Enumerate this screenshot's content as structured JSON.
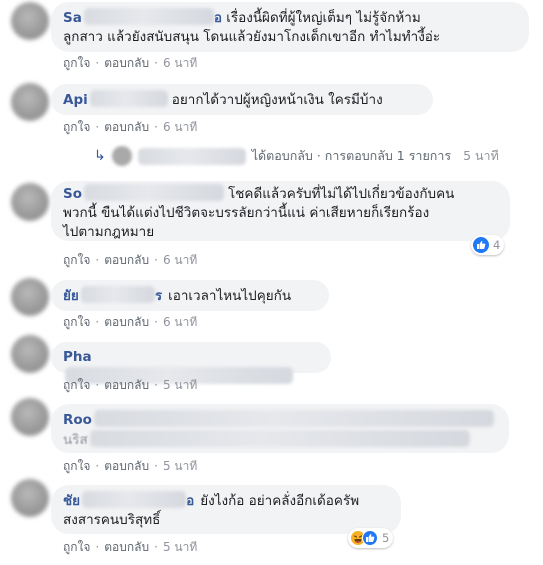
{
  "colors": {
    "name": "#385898",
    "bubble": "#f2f3f5",
    "meta": "#90949c",
    "like": "#2078f4"
  },
  "actions": {
    "like": "ถูกใจ",
    "reply": "ตอบกลับ",
    "sep": "·"
  },
  "comments": [
    {
      "name_visible": "Sa",
      "name_end": "อ",
      "lines": [
        "เรื่องนี้ผิดที่ผู้ใหญ่เต็มๆ ไม่รู้จักห้าม",
        "ลูกสาว แล้วยังสนับสนุน โดนแล้วยังมาโกงเด็กเขาอีก ทำไมทำงี้อ่ะ"
      ],
      "time": "6 นาที"
    },
    {
      "name_visible": "Api",
      "lines": [
        "อยากได้วาปผู้หญิงหน้าเงิน ใครมีบ้าง"
      ],
      "time": "6 นาที",
      "reply_summary": {
        "text": "ได้ตอบกลับ · การตอบกลับ 1 รายการ",
        "time": "5 นาที"
      }
    },
    {
      "name_visible": "So",
      "lines": [
        "โชคดีแล้วครับที่ไม่ได้ไปเกี่ยวข้องกับคน",
        "พวกนี้ ขืนได้แต่งไปชีวิตจะบรรลัยกว่านี้แน่ ค่าเสียหายก็เรียกร้อง",
        "ไปตามกฎหมาย"
      ],
      "time": "6 นาที",
      "reactions": {
        "icons": [
          "like-icon"
        ],
        "count": "4"
      }
    },
    {
      "name_visible": "ยัย",
      "name_end": "ร",
      "lines": [
        "เอาเวลาไหนไปคุยกัน"
      ],
      "time": "6 นาที"
    },
    {
      "name_visible": "Pha",
      "lines": [
        ""
      ],
      "time": "5 นาที"
    },
    {
      "name_visible": "Roo",
      "lines": [
        "",
        "นริส"
      ],
      "time": "5 นาที"
    },
    {
      "name_visible": "ชัย",
      "name_end": "อ",
      "lines": [
        "ยังไงก้อ อย่าคลั่งอีกเด้อครัพ",
        "สงสารคนบริสุทธิ์"
      ],
      "time": "5 นาที",
      "reactions": {
        "icons": [
          "haha-icon",
          "like-icon"
        ],
        "count": "5"
      }
    }
  ]
}
